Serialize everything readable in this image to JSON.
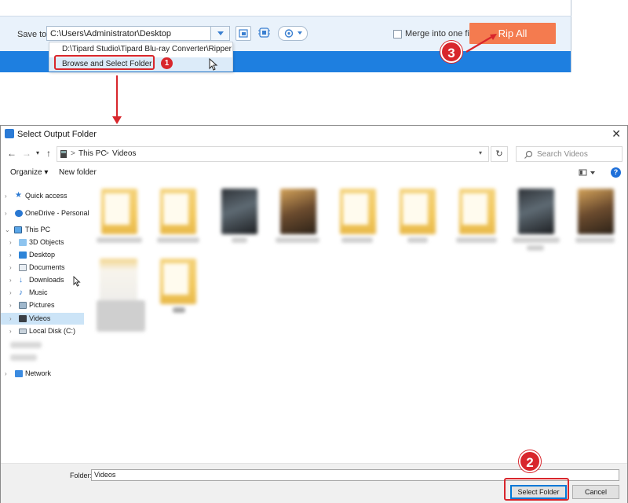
{
  "app": {
    "save_to_label": "Save to:",
    "save_path": "C:\\Users\\Administrator\\Desktop",
    "dropdown_items": [
      "D:\\Tipard Studio\\Tipard Blu-ray Converter\\Ripper",
      "Browse and Select Folder"
    ],
    "merge_label": "Merge into one file",
    "merge_checked": false,
    "rip_label": "Rip All",
    "accent_color": "#f47b4f"
  },
  "steps": {
    "one": "1",
    "two": "2",
    "three": "3"
  },
  "dialog": {
    "title": "Select Output Folder",
    "close_glyph": "✕",
    "address": {
      "root": "This PC",
      "current": "Videos",
      "separator": ">"
    },
    "search_placeholder": "Search Videos",
    "toolbar": {
      "organize": "Organize ▾",
      "new_folder": "New folder",
      "help": "?"
    },
    "tree": [
      {
        "label": "Quick access",
        "icon": "star-icon"
      },
      {
        "label": "OneDrive - Personal",
        "icon": "cloud-icon"
      },
      {
        "label": "This PC",
        "icon": "computer-icon"
      },
      {
        "label": "3D Objects",
        "icon": "cube-icon"
      },
      {
        "label": "Desktop",
        "icon": "desktop-icon"
      },
      {
        "label": "Documents",
        "icon": "document-icon"
      },
      {
        "label": "Downloads",
        "icon": "download-icon"
      },
      {
        "label": "Music",
        "icon": "music-icon"
      },
      {
        "label": "Pictures",
        "icon": "picture-icon"
      },
      {
        "label": "Videos",
        "icon": "video-icon"
      },
      {
        "label": "Local Disk (C:)",
        "icon": "disk-icon"
      },
      {
        "label": "Network",
        "icon": "network-icon"
      }
    ],
    "selected_tree_item": "Videos",
    "folder_label": "Folder:",
    "folder_value": "Videos",
    "select_button": "Select Folder",
    "cancel_button": "Cancel"
  }
}
